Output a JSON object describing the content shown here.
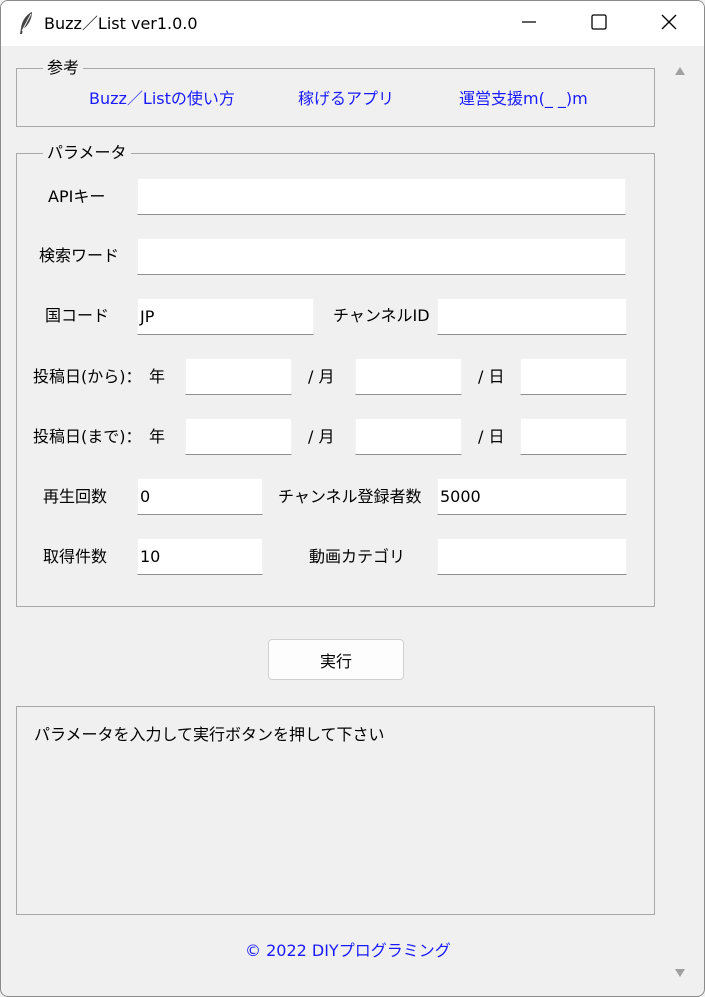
{
  "window": {
    "title": "Buzz／List ver1.0.0",
    "icons": {
      "app": "feather-icon",
      "minimize": "minimize-icon",
      "maximize": "maximize-icon",
      "close": "close-icon"
    }
  },
  "reference": {
    "legend": "参考",
    "links": [
      "Buzz／Listの使い方",
      "稼げるアプリ",
      "運営支援m(_ _)m"
    ]
  },
  "params": {
    "legend": "パラメータ",
    "api_key_label": "APIキー",
    "api_key_value": "",
    "search_word_label": "検索ワード",
    "search_word_value": "",
    "country_code_label": "国コード",
    "country_code_value": "JP",
    "channel_id_label": "チャンネルID",
    "channel_id_value": "",
    "date_from_label": "投稿日(から)：",
    "date_to_label": "投稿日(まで)：",
    "year_label": "年",
    "month_label": "/ 月",
    "day_label": "/ 日",
    "date_from": {
      "year": "",
      "month": "",
      "day": ""
    },
    "date_to": {
      "year": "",
      "month": "",
      "day": ""
    },
    "view_count_label": "再生回数",
    "view_count_value": "0",
    "subscribers_label": "チャンネル登録者数",
    "subscribers_value": "5000",
    "max_results_label": "取得件数",
    "max_results_value": "10",
    "category_label": "動画カテゴリ",
    "category_value": ""
  },
  "run_button_label": "実行",
  "output_message": "パラメータを入力して実行ボタンを押して下さい",
  "footer": "© 2022 DIYプログラミング",
  "colors": {
    "link": "#1a1aff",
    "background": "#f0f0f0",
    "titlebar": "#ffffff"
  }
}
